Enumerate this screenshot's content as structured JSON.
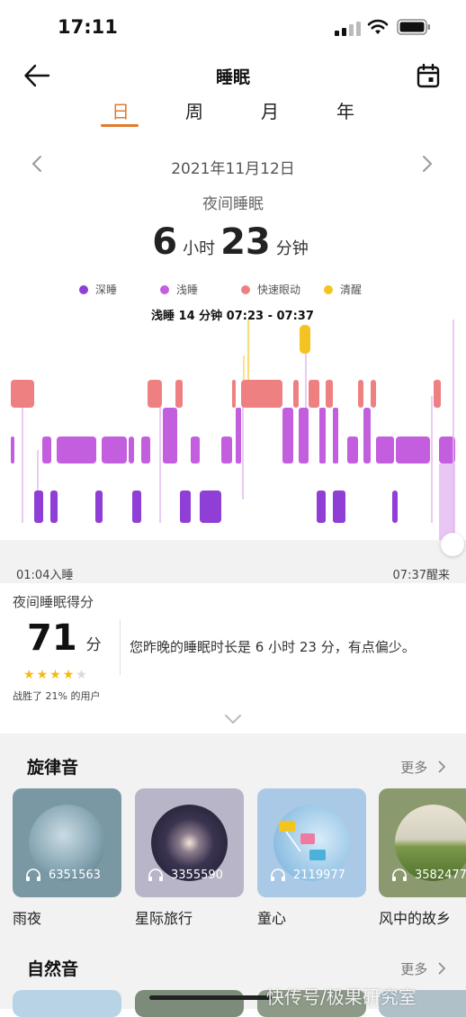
{
  "status_bar": {
    "time": "17:11"
  },
  "header": {
    "title": "睡眠"
  },
  "tabs": [
    {
      "label": "日",
      "active": true
    },
    {
      "label": "周",
      "active": false
    },
    {
      "label": "月",
      "active": false
    },
    {
      "label": "年",
      "active": false
    }
  ],
  "date_nav": {
    "date": "2021年11月12日"
  },
  "summary": {
    "label": "夜间睡眠",
    "hours": "6",
    "hours_unit": "小时",
    "minutes": "23",
    "minutes_unit": "分钟"
  },
  "legend": [
    {
      "label": "深睡",
      "color": "#8f3fd6"
    },
    {
      "label": "浅睡",
      "color": "#c35fdf"
    },
    {
      "label": "快速眼动",
      "color": "#ef8082"
    },
    {
      "label": "清醒",
      "color": "#f3c322"
    }
  ],
  "tooltip": "浅睡 14 分钟 07:23 - 07:37",
  "sleep_times": {
    "start": "01:04入睡",
    "end": "07:37醒来"
  },
  "score": {
    "title": "夜间睡眠得分",
    "value": "71",
    "unit": "分",
    "stars_filled": 4,
    "stars_total": 5,
    "beat": "战胜了 21% 的用户",
    "comment": "您昨晚的睡眠时长是 6 小时 23 分，有点偏少。"
  },
  "melody": {
    "title": "旋律音",
    "more": "更多",
    "items": [
      {
        "label": "雨夜",
        "count": "6351563"
      },
      {
        "label": "星际旅行",
        "count": "3355590"
      },
      {
        "label": "童心",
        "count": "2119977"
      },
      {
        "label": "风中的故乡",
        "count": "3582477"
      }
    ]
  },
  "nature": {
    "title": "自然音",
    "more": "更多"
  },
  "watermark": "快传号/极果研究室"
}
